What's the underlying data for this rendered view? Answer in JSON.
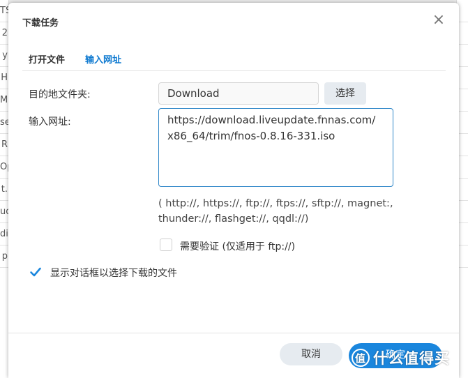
{
  "background": {
    "left_rows": [
      "TS",
      "2",
      "y",
      "H",
      "M",
      "se",
      "R",
      "Op",
      "t.",
      "ud",
      "di",
      "p"
    ],
    "right_rows": [
      "",
      "",
      "",
      "",
      "",
      "",
      "",
      "",
      "",
      "",
      "",
      ""
    ]
  },
  "dialog": {
    "title": "下载任务",
    "close_icon": "close-icon",
    "tabs": [
      {
        "label": "打开文件",
        "active": false
      },
      {
        "label": "输入网址",
        "active": true
      }
    ],
    "destination": {
      "label": "目的地文件夹:",
      "value": "Download",
      "choose_label": "选择"
    },
    "url": {
      "label": "输入网址:",
      "value": "https://download.liveupdate.fnnas.com/\nx86_64/trim/fnos-0.8.16-331.iso"
    },
    "protocols_hint": "( http://, https://, ftp://, ftps://, sftp://, magnet:, thunder://, flashget://, qqdl://)",
    "auth_checkbox": {
      "label": "需要验证 (仅适用于 ftp://)",
      "checked": false
    },
    "show_dialog_checkbox": {
      "label": "显示对话框以选择下载的文件",
      "checked": true
    },
    "footer": {
      "cancel_label": "取消",
      "ok_label": "确定"
    }
  },
  "watermark": {
    "logo": "值",
    "text": "什么值得买"
  },
  "colors": {
    "accent": "#1a86dd",
    "tab_active": "#0d79d0",
    "checkbox": "#1a86dd"
  }
}
